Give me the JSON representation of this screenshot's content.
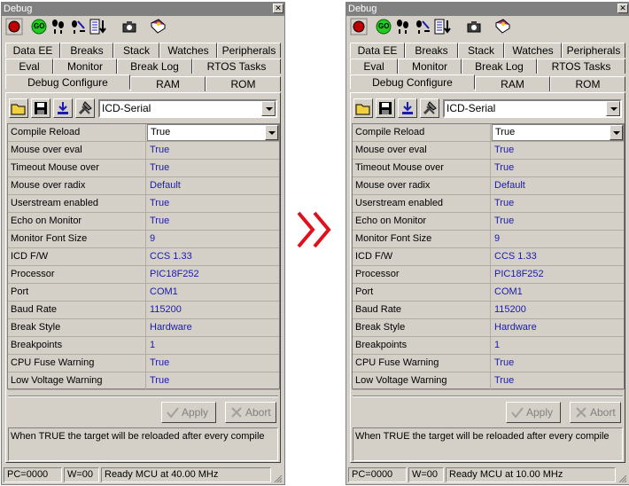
{
  "colors": {
    "arrow": "#e0101c",
    "value_text": "#1a1ab0",
    "title_bg": "#808080",
    "panel_bg": "#d4d0c8"
  },
  "separator_icon": "double-chevron-right",
  "panels": [
    {
      "title": "Debug",
      "toolbar_icons": [
        "record-icon",
        "go-icon",
        "step-into-icon",
        "step-over-icon",
        "step-out-icon",
        "camera-icon",
        "book-icon"
      ],
      "go_label": "GO",
      "tabs_row1": [
        "Data EE",
        "Breaks",
        "Stack",
        "Watches",
        "Peripherals"
      ],
      "tabs_row2": [
        "Eval",
        "Monitor",
        "Break Log",
        "RTOS Tasks"
      ],
      "tabs_row3": [
        "Debug Configure",
        "RAM",
        "ROM"
      ],
      "active_tab": "Debug Configure",
      "interface_select": "ICD-Serial",
      "properties": [
        {
          "key": "Compile Reload",
          "value": "True"
        },
        {
          "key": "Mouse over eval",
          "value": "True"
        },
        {
          "key": "Timeout Mouse over",
          "value": "True"
        },
        {
          "key": "Mouse over radix",
          "value": "Default"
        },
        {
          "key": "Userstream enabled",
          "value": "True"
        },
        {
          "key": "Echo on Monitor",
          "value": "True"
        },
        {
          "key": "Monitor Font Size",
          "value": "9"
        },
        {
          "key": "ICD F/W",
          "value": "CCS 1.33"
        },
        {
          "key": "Processor",
          "value": "PIC18F252"
        },
        {
          "key": "Port",
          "value": "COM1"
        },
        {
          "key": "Baud Rate",
          "value": "115200"
        },
        {
          "key": "Break Style",
          "value": "Hardware"
        },
        {
          "key": "Breakpoints",
          "value": "1"
        },
        {
          "key": "CPU Fuse Warning",
          "value": "True"
        },
        {
          "key": "Low Voltage Warning",
          "value": "True"
        }
      ],
      "apply_label": "Apply",
      "abort_label": "Abort",
      "description": "When TRUE the target will be reloaded after every compile",
      "status": {
        "pc": "PC=0000",
        "w": "W=00",
        "message": "Ready MCU at 40.00 MHz"
      }
    },
    {
      "title": "Debug",
      "toolbar_icons": [
        "record-icon",
        "go-icon",
        "step-into-icon",
        "step-over-icon",
        "step-out-icon",
        "camera-icon",
        "book-icon"
      ],
      "go_label": "GO",
      "tabs_row1": [
        "Data EE",
        "Breaks",
        "Stack",
        "Watches",
        "Peripherals"
      ],
      "tabs_row2": [
        "Eval",
        "Monitor",
        "Break Log",
        "RTOS Tasks"
      ],
      "tabs_row3": [
        "Debug Configure",
        "RAM",
        "ROM"
      ],
      "active_tab": "Debug Configure",
      "interface_select": "ICD-Serial",
      "properties": [
        {
          "key": "Compile Reload",
          "value": "True"
        },
        {
          "key": "Mouse over eval",
          "value": "True"
        },
        {
          "key": "Timeout Mouse over",
          "value": "True"
        },
        {
          "key": "Mouse over radix",
          "value": "Default"
        },
        {
          "key": "Userstream enabled",
          "value": "True"
        },
        {
          "key": "Echo on Monitor",
          "value": "True"
        },
        {
          "key": "Monitor Font Size",
          "value": "9"
        },
        {
          "key": "ICD F/W",
          "value": "CCS 1.33"
        },
        {
          "key": "Processor",
          "value": "PIC18F252"
        },
        {
          "key": "Port",
          "value": "COM1"
        },
        {
          "key": "Baud Rate",
          "value": "115200"
        },
        {
          "key": "Break Style",
          "value": "Hardware"
        },
        {
          "key": "Breakpoints",
          "value": "1"
        },
        {
          "key": "CPU Fuse Warning",
          "value": "True"
        },
        {
          "key": "Low Voltage Warning",
          "value": "True"
        }
      ],
      "apply_label": "Apply",
      "abort_label": "Abort",
      "description": "When TRUE the target will be reloaded after every compile",
      "status": {
        "pc": "PC=0000",
        "w": "W=00",
        "message": "Ready MCU at 10.00 MHz"
      }
    }
  ]
}
